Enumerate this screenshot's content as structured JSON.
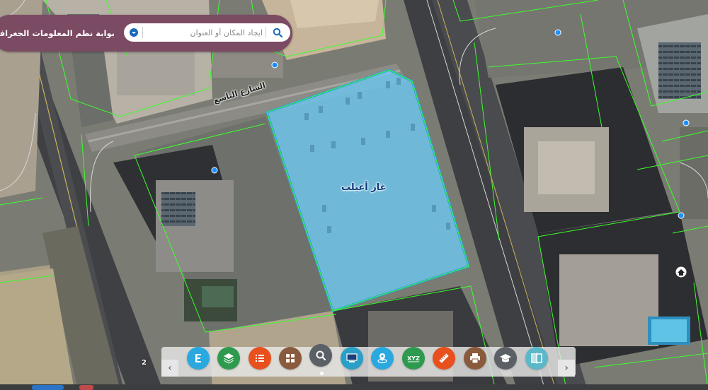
{
  "header": {
    "title": "بوابة نظم المعلومات الجغرافية",
    "search_placeholder": "ايجاد المكان أو العنوان"
  },
  "map": {
    "street_label": "الشارع التاسع",
    "parcel_label": "غار أعيلب",
    "small_text": "2"
  },
  "colors": {
    "header_bg": "#7b4a63",
    "parcel_fill": "#6ec6ee",
    "parcel_outline": "#2f9fe0",
    "boundary_line": "#3bff2b",
    "poi_dot": "#1e8fff"
  },
  "toolbar": {
    "tools": [
      {
        "name": "tool-e",
        "icon": "E",
        "color": "#2aa8e0"
      },
      {
        "name": "tool-layers",
        "icon": "layers-icon",
        "color": "#2e9a4e"
      },
      {
        "name": "tool-legend",
        "icon": "list-icon",
        "color": "#e8501e"
      },
      {
        "name": "tool-basemap",
        "icon": "grid-icon",
        "color": "#8a5a3c"
      },
      {
        "name": "tool-search",
        "icon": "search-icon",
        "color": "#5b5f66"
      },
      {
        "name": "tool-screen",
        "icon": "monitor-icon",
        "color": "#2aa0c8"
      },
      {
        "name": "tool-location",
        "icon": "location-icon",
        "color": "#2aa8e0"
      },
      {
        "name": "tool-xyz",
        "icon": "XYZ",
        "color": "#2e9a4e"
      },
      {
        "name": "tool-measure",
        "icon": "ruler-icon",
        "color": "#e8501e"
      },
      {
        "name": "tool-print",
        "icon": "print-icon",
        "color": "#8a5a3c"
      },
      {
        "name": "tool-education",
        "icon": "graduation-cap-icon",
        "color": "#5b5f66"
      },
      {
        "name": "tool-compare",
        "icon": "compare-icon",
        "color": "#5ab8c8"
      }
    ]
  }
}
